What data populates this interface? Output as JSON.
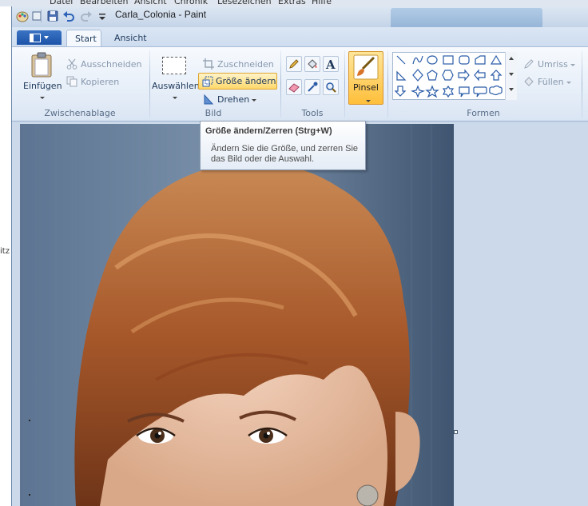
{
  "background_app": {
    "menu": [
      "Datei",
      "Bearbeiten",
      "Ansicht",
      "Chronik",
      "Lesezeichen",
      "Extras",
      "Hilfe"
    ],
    "left_edge_text": "itz"
  },
  "window": {
    "title": "Carla_Colonia - Paint"
  },
  "tabs": [
    {
      "label": "Start"
    },
    {
      "label": "Ansicht"
    }
  ],
  "ribbon": {
    "zwischenablage": {
      "label": "Zwischenablage",
      "paste": "Einfügen",
      "cut": "Ausschneiden",
      "copy": "Kopieren"
    },
    "bild": {
      "label": "Bild",
      "select": "Auswählen",
      "crop": "Zuschneiden",
      "resize": "Größe ändern",
      "rotate": "Drehen"
    },
    "tools": {
      "label": "Tools"
    },
    "brush": {
      "label": "Pinsel"
    },
    "formen": {
      "label": "Formen",
      "outline": "Umriss",
      "fill": "Füllen"
    }
  },
  "tooltip": {
    "title": "Größe ändern/Zerren (Strg+W)",
    "body": "Ändern Sie die Größe, und zerren Sie das Bild oder die Auswahl."
  },
  "colors": {
    "accent": "#1d53a8",
    "highlight": "#ffd86b",
    "ribbon_text": "#1e395b"
  }
}
